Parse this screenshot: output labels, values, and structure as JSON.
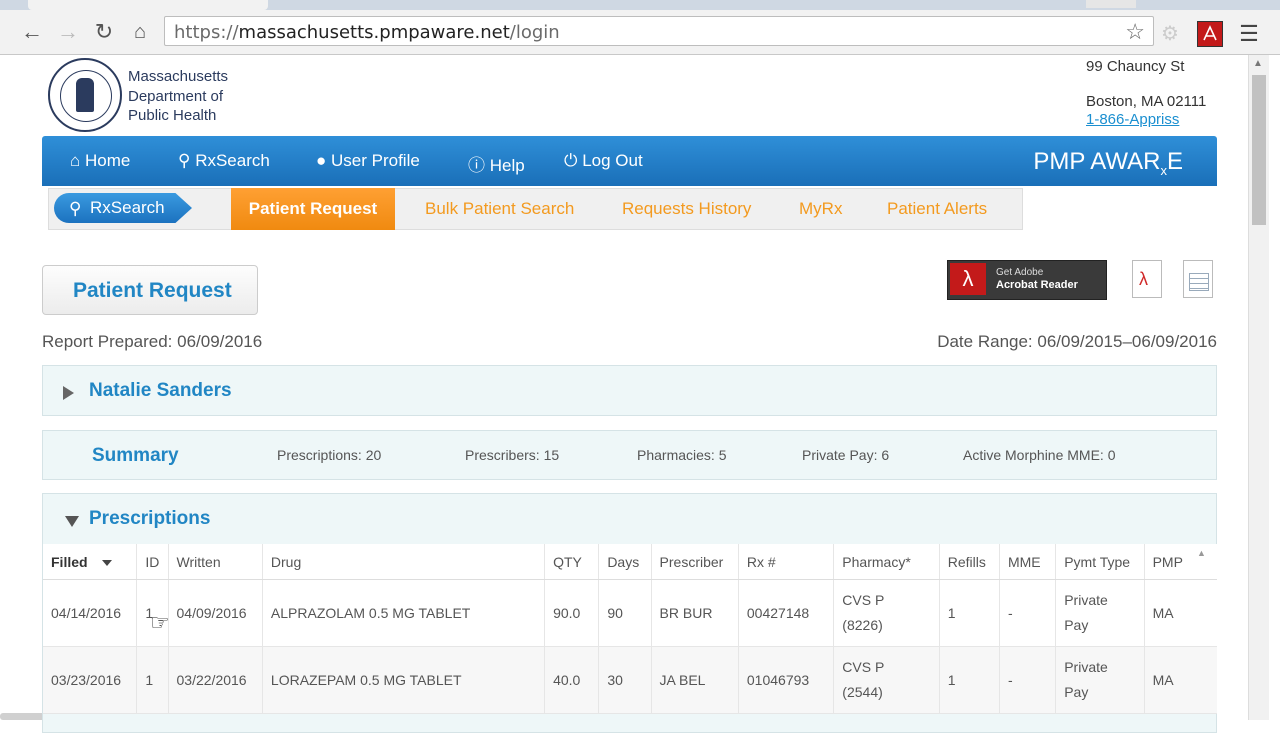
{
  "browser": {
    "url_prefix": "https://",
    "url_host": "massachusetts.pmpaware.net",
    "url_path": "/login"
  },
  "header": {
    "dept_line1": "Massachusetts",
    "dept_line2": "Department of",
    "dept_line3": "Public Health",
    "address_line1": "99 Chauncy St",
    "address_line2": "Boston, MA 02111",
    "phone": "1-866-Appriss"
  },
  "mainnav": {
    "home": "Home",
    "rxsearch": "RxSearch",
    "user_profile": "User Profile",
    "help": "Help",
    "logout": "Log Out",
    "brand_a": "PMP AWAR",
    "brand_x": "x",
    "brand_e": "E"
  },
  "subnav": {
    "pill": "RxSearch",
    "patient_request": "Patient Request",
    "bulk": "Bulk Patient Search",
    "history": "Requests History",
    "myrx": "MyRx",
    "alerts": "Patient Alerts"
  },
  "page": {
    "title": "Patient Request",
    "acrobat_line1": "Get Adobe",
    "acrobat_line2": "Acrobat Reader",
    "report_prepared": "Report Prepared: 06/09/2016",
    "date_range": "Date Range: 06/09/2015–06/09/2016"
  },
  "patient": {
    "name": "Natalie Sanders"
  },
  "summary": {
    "title": "Summary",
    "prescriptions": "Prescriptions: 20",
    "prescribers": "Prescribers: 15",
    "pharmacies": "Pharmacies: 5",
    "private_pay": "Private Pay: 6",
    "mme": "Active Morphine MME: 0"
  },
  "prescriptions": {
    "title": "Prescriptions",
    "columns": [
      "Filled",
      "ID",
      "Written",
      "Drug",
      "QTY",
      "Days",
      "Prescriber",
      "Rx #",
      "Pharmacy*",
      "Refills",
      "MME",
      "Pymt Type",
      "PMP"
    ],
    "rows": [
      {
        "filled": "04/14/2016",
        "id": "1",
        "written": "04/09/2016",
        "drug": "ALPRAZOLAM 0.5 MG TABLET",
        "qty": "90.0",
        "days": "90",
        "prescriber": "BR BUR",
        "rx": "00427148",
        "pharmacy_name": "CVS P",
        "pharmacy_id": "(8226)",
        "refills": "1",
        "mme": "-",
        "pay1": "Private",
        "pay2": "Pay",
        "pmp": "MA"
      },
      {
        "filled": "03/23/2016",
        "id": "1",
        "written": "03/22/2016",
        "drug": "LORAZEPAM 0.5 MG TABLET",
        "qty": "40.0",
        "days": "30",
        "prescriber": "JA BEL",
        "rx": "01046793",
        "pharmacy_name": "CVS P",
        "pharmacy_id": "(2544)",
        "refills": "1",
        "mme": "-",
        "pay1": "Private",
        "pay2": "Pay",
        "pmp": "MA"
      }
    ]
  }
}
